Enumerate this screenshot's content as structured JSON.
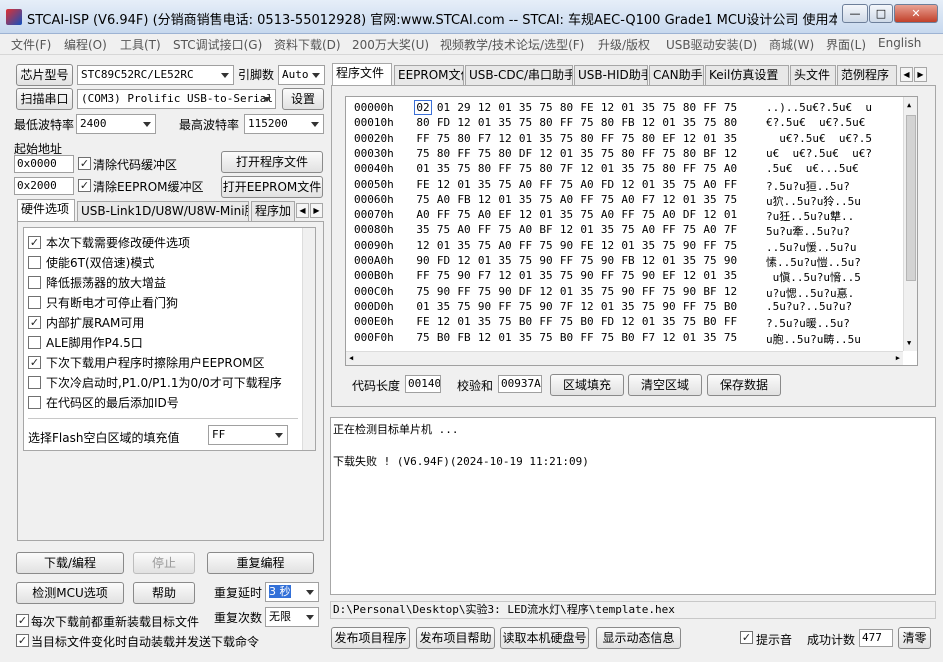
{
  "title": "STCAI-ISP (V6.94F) (分销商销售电话: 0513-55012928) 官网:www.STCAI.com  -- STCAI: 车规AEC-Q100 Grade1 MCU设计公司 使用本司芯片或采...",
  "window_controls": {
    "minimize": "—",
    "maximize": "□",
    "close": "✕"
  },
  "menu": [
    "文件(F)",
    "编程(O)",
    "工具(T)",
    "STC调试接口(G)",
    "资料下载(D)",
    "200万大奖(U)",
    "视频教学/技术论坛/选型(F)",
    "升级/版权",
    "USB驱动安装(D)",
    "商城(W)",
    "界面(L)",
    "English"
  ],
  "left": {
    "chip_model_button": "芯片型号",
    "chip_model_value": "STC89C52RC/LE52RC",
    "pin_count_label": "引脚数",
    "pin_count_value": "Auto",
    "scan_port_button": "扫描串口",
    "port_value": "(COM3) Prolific USB-to-Serial",
    "settings_button": "设置",
    "min_baud_label": "最低波特率",
    "min_baud_value": "2400",
    "max_baud_label": "最高波特率",
    "max_baud_value": "115200",
    "start_addr_label": "起始地址",
    "code_addr": "0x0000",
    "clear_code_label": "清除代码缓冲区",
    "open_program_button": "打开程序文件",
    "eeprom_addr": "0x2000",
    "clear_eeprom_label": "清除EEPROM缓冲区",
    "open_eeprom_button": "打开EEPROM文件",
    "tabs": [
      "硬件选项",
      "USB-Link1D/U8W/U8W-Mini脱机",
      "程序加"
    ],
    "options": [
      {
        "label": "本次下载需要修改硬件选项",
        "checked": true
      },
      {
        "label": "使能6T(双倍速)模式",
        "checked": false
      },
      {
        "label": "降低振荡器的放大增益",
        "checked": false
      },
      {
        "label": "只有断电才可停止看门狗",
        "checked": false
      },
      {
        "label": "内部扩展RAM可用",
        "checked": true
      },
      {
        "label": "ALE脚用作P4.5口",
        "checked": false
      },
      {
        "label": "下次下载用户程序时擦除用户EEPROM区",
        "checked": true
      },
      {
        "label": "下次冷启动时,P1.0/P1.1为0/0才可下载程序",
        "checked": false
      },
      {
        "label": "在代码区的最后添加ID号",
        "checked": false
      }
    ],
    "fill_label": "选择Flash空白区域的填充值",
    "fill_value": "FF",
    "download_button": "下载/编程",
    "stop_button": "停止",
    "reprogram_button": "重复编程",
    "detect_button": "检测MCU选项",
    "help_button": "帮助",
    "repeat_delay_label": "重复延时",
    "repeat_delay_value": "3 秒",
    "repeat_count_label": "重复次数",
    "repeat_count_value": "无限",
    "reload_label": "每次下载前都重新装载目标文件",
    "auto_load_label": "当目标文件变化时自动装载并发送下载命令"
  },
  "right": {
    "tabs": [
      "程序文件",
      "EEPROM文件",
      "USB-CDC/串口助手",
      "USB-HID助手",
      "CAN助手",
      "Keil仿真设置",
      "头文件",
      "范例程序"
    ],
    "hex_rows": [
      {
        "addr": "00000h",
        "bytes": [
          "02",
          "01",
          "29",
          "12",
          "01",
          "35",
          "75",
          "80",
          "FE",
          "12",
          "01",
          "35",
          "75",
          "80",
          "FF",
          "75"
        ],
        "ascii": "..)..5u€?.5u€  u"
      },
      {
        "addr": "00010h",
        "bytes": [
          "80",
          "FD",
          "12",
          "01",
          "35",
          "75",
          "80",
          "FF",
          "75",
          "80",
          "FB",
          "12",
          "01",
          "35",
          "75",
          "80"
        ],
        "ascii": "€?.5u€  u€?.5u€"
      },
      {
        "addr": "00020h",
        "bytes": [
          "FF",
          "75",
          "80",
          "F7",
          "12",
          "01",
          "35",
          "75",
          "80",
          "FF",
          "75",
          "80",
          "EF",
          "12",
          "01",
          "35"
        ],
        "ascii": "  u€?.5u€  u€?.5"
      },
      {
        "addr": "00030h",
        "bytes": [
          "75",
          "80",
          "FF",
          "75",
          "80",
          "DF",
          "12",
          "01",
          "35",
          "75",
          "80",
          "FF",
          "75",
          "80",
          "BF",
          "12"
        ],
        "ascii": "u€  u€?.5u€  u€?"
      },
      {
        "addr": "00040h",
        "bytes": [
          "01",
          "35",
          "75",
          "80",
          "FF",
          "75",
          "80",
          "7F",
          "12",
          "01",
          "35",
          "75",
          "80",
          "FF",
          "75",
          "A0"
        ],
        "ascii": ".5u€  u€...5u€"
      },
      {
        "addr": "00050h",
        "bytes": [
          "FE",
          "12",
          "01",
          "35",
          "75",
          "A0",
          "FF",
          "75",
          "A0",
          "FD",
          "12",
          "01",
          "35",
          "75",
          "A0",
          "FF"
        ],
        "ascii": "?.5u?u狟..5u?"
      },
      {
        "addr": "00060h",
        "bytes": [
          "75",
          "A0",
          "FB",
          "12",
          "01",
          "35",
          "75",
          "A0",
          "FF",
          "75",
          "A0",
          "F7",
          "12",
          "01",
          "35",
          "75"
        ],
        "ascii": "u狖..5u?u狑..5u"
      },
      {
        "addr": "00070h",
        "bytes": [
          "A0",
          "FF",
          "75",
          "A0",
          "EF",
          "12",
          "01",
          "35",
          "75",
          "A0",
          "FF",
          "75",
          "A0",
          "DF",
          "12",
          "01"
        ],
        "ascii": "?u狅..5u?u犨.."
      },
      {
        "addr": "00080h",
        "bytes": [
          "35",
          "75",
          "A0",
          "FF",
          "75",
          "A0",
          "BF",
          "12",
          "01",
          "35",
          "75",
          "A0",
          "FF",
          "75",
          "A0",
          "7F"
        ],
        "ascii": "5u?u牽..5u?u?"
      },
      {
        "addr": "00090h",
        "bytes": [
          "12",
          "01",
          "35",
          "75",
          "A0",
          "FF",
          "75",
          "90",
          "FE",
          "12",
          "01",
          "35",
          "75",
          "90",
          "FF",
          "75"
        ],
        "ascii": "..5u?u愋..5u?u"
      },
      {
        "addr": "000A0h",
        "bytes": [
          "90",
          "FD",
          "12",
          "01",
          "35",
          "75",
          "90",
          "FF",
          "75",
          "90",
          "FB",
          "12",
          "01",
          "35",
          "75",
          "90"
        ],
        "ascii": "愫..5u?u愷..5u?"
      },
      {
        "addr": "000B0h",
        "bytes": [
          "FF",
          "75",
          "90",
          "F7",
          "12",
          "01",
          "35",
          "75",
          "90",
          "FF",
          "75",
          "90",
          "EF",
          "12",
          "01",
          "35"
        ],
        "ascii": " u愼..5u?u愶..5"
      },
      {
        "addr": "000C0h",
        "bytes": [
          "75",
          "90",
          "FF",
          "75",
          "90",
          "DF",
          "12",
          "01",
          "35",
          "75",
          "90",
          "FF",
          "75",
          "90",
          "BF",
          "12"
        ],
        "ascii": "u?u愢..5u?u惪."
      },
      {
        "addr": "000D0h",
        "bytes": [
          "01",
          "35",
          "75",
          "90",
          "FF",
          "75",
          "90",
          "7F",
          "12",
          "01",
          "35",
          "75",
          "90",
          "FF",
          "75",
          "B0"
        ],
        "ascii": ".5u?u?..5u?u?"
      },
      {
        "addr": "000E0h",
        "bytes": [
          "FE",
          "12",
          "01",
          "35",
          "75",
          "B0",
          "FF",
          "75",
          "B0",
          "FD",
          "12",
          "01",
          "35",
          "75",
          "B0",
          "FF"
        ],
        "ascii": "?.5u?u暖..5u?"
      },
      {
        "addr": "000F0h",
        "bytes": [
          "75",
          "B0",
          "FB",
          "12",
          "01",
          "35",
          "75",
          "B0",
          "FF",
          "75",
          "B0",
          "F7",
          "12",
          "01",
          "35",
          "75"
        ],
        "ascii": "u胞..5u?u畴..5u"
      }
    ],
    "code_len_label": "代码长度",
    "code_len_value": "00140",
    "checksum_label": "校验和",
    "checksum_value": "00937A",
    "fill_area_button": "区域填充",
    "clear_area_button": "清空区域",
    "save_data_button": "保存数据",
    "log_lines": [
      "正在检测目标单片机 ...",
      "",
      "下载失败 ! (V6.94F)(2024-10-19 11:21:09)"
    ],
    "file_path": "D:\\Personal\\Desktop\\实验3: LED流水灯\\程序\\template.hex",
    "publish_program_button": "发布项目程序",
    "publish_help_button": "发布项目帮助",
    "read_disk_button": "读取本机硬盘号",
    "show_info_button": "显示动态信息",
    "sound_label": "提示音",
    "success_count_label": "成功计数",
    "success_count_value": "477",
    "clear_button": "清零"
  }
}
